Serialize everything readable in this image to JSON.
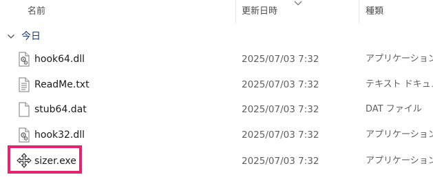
{
  "columns": {
    "name": "名前",
    "date": "更新日時",
    "type": "種類"
  },
  "group": {
    "label": "今日",
    "chevron_icon": "chevron-down-icon"
  },
  "files": [
    {
      "name": "hook64.dll",
      "date": "2025/07/03 7:32",
      "type": "アプリケーション拡",
      "icon": "dll-file-icon"
    },
    {
      "name": "ReadMe.txt",
      "date": "2025/07/03 7:32",
      "type": "テキスト ドキュメン",
      "icon": "text-file-icon"
    },
    {
      "name": "stub64.dat",
      "date": "2025/07/03 7:32",
      "type": "DAT ファイル",
      "icon": "blank-file-icon"
    },
    {
      "name": "hook32.dll",
      "date": "2025/07/03 7:32",
      "type": "アプリケーション拡",
      "icon": "dll-file-icon"
    },
    {
      "name": "sizer.exe",
      "date": "2025/07/03 7:32",
      "type": "アプリケーション",
      "icon": "move-arrows-icon"
    }
  ],
  "highlight": {
    "target": "sizer.exe",
    "color": "#e8236e"
  }
}
